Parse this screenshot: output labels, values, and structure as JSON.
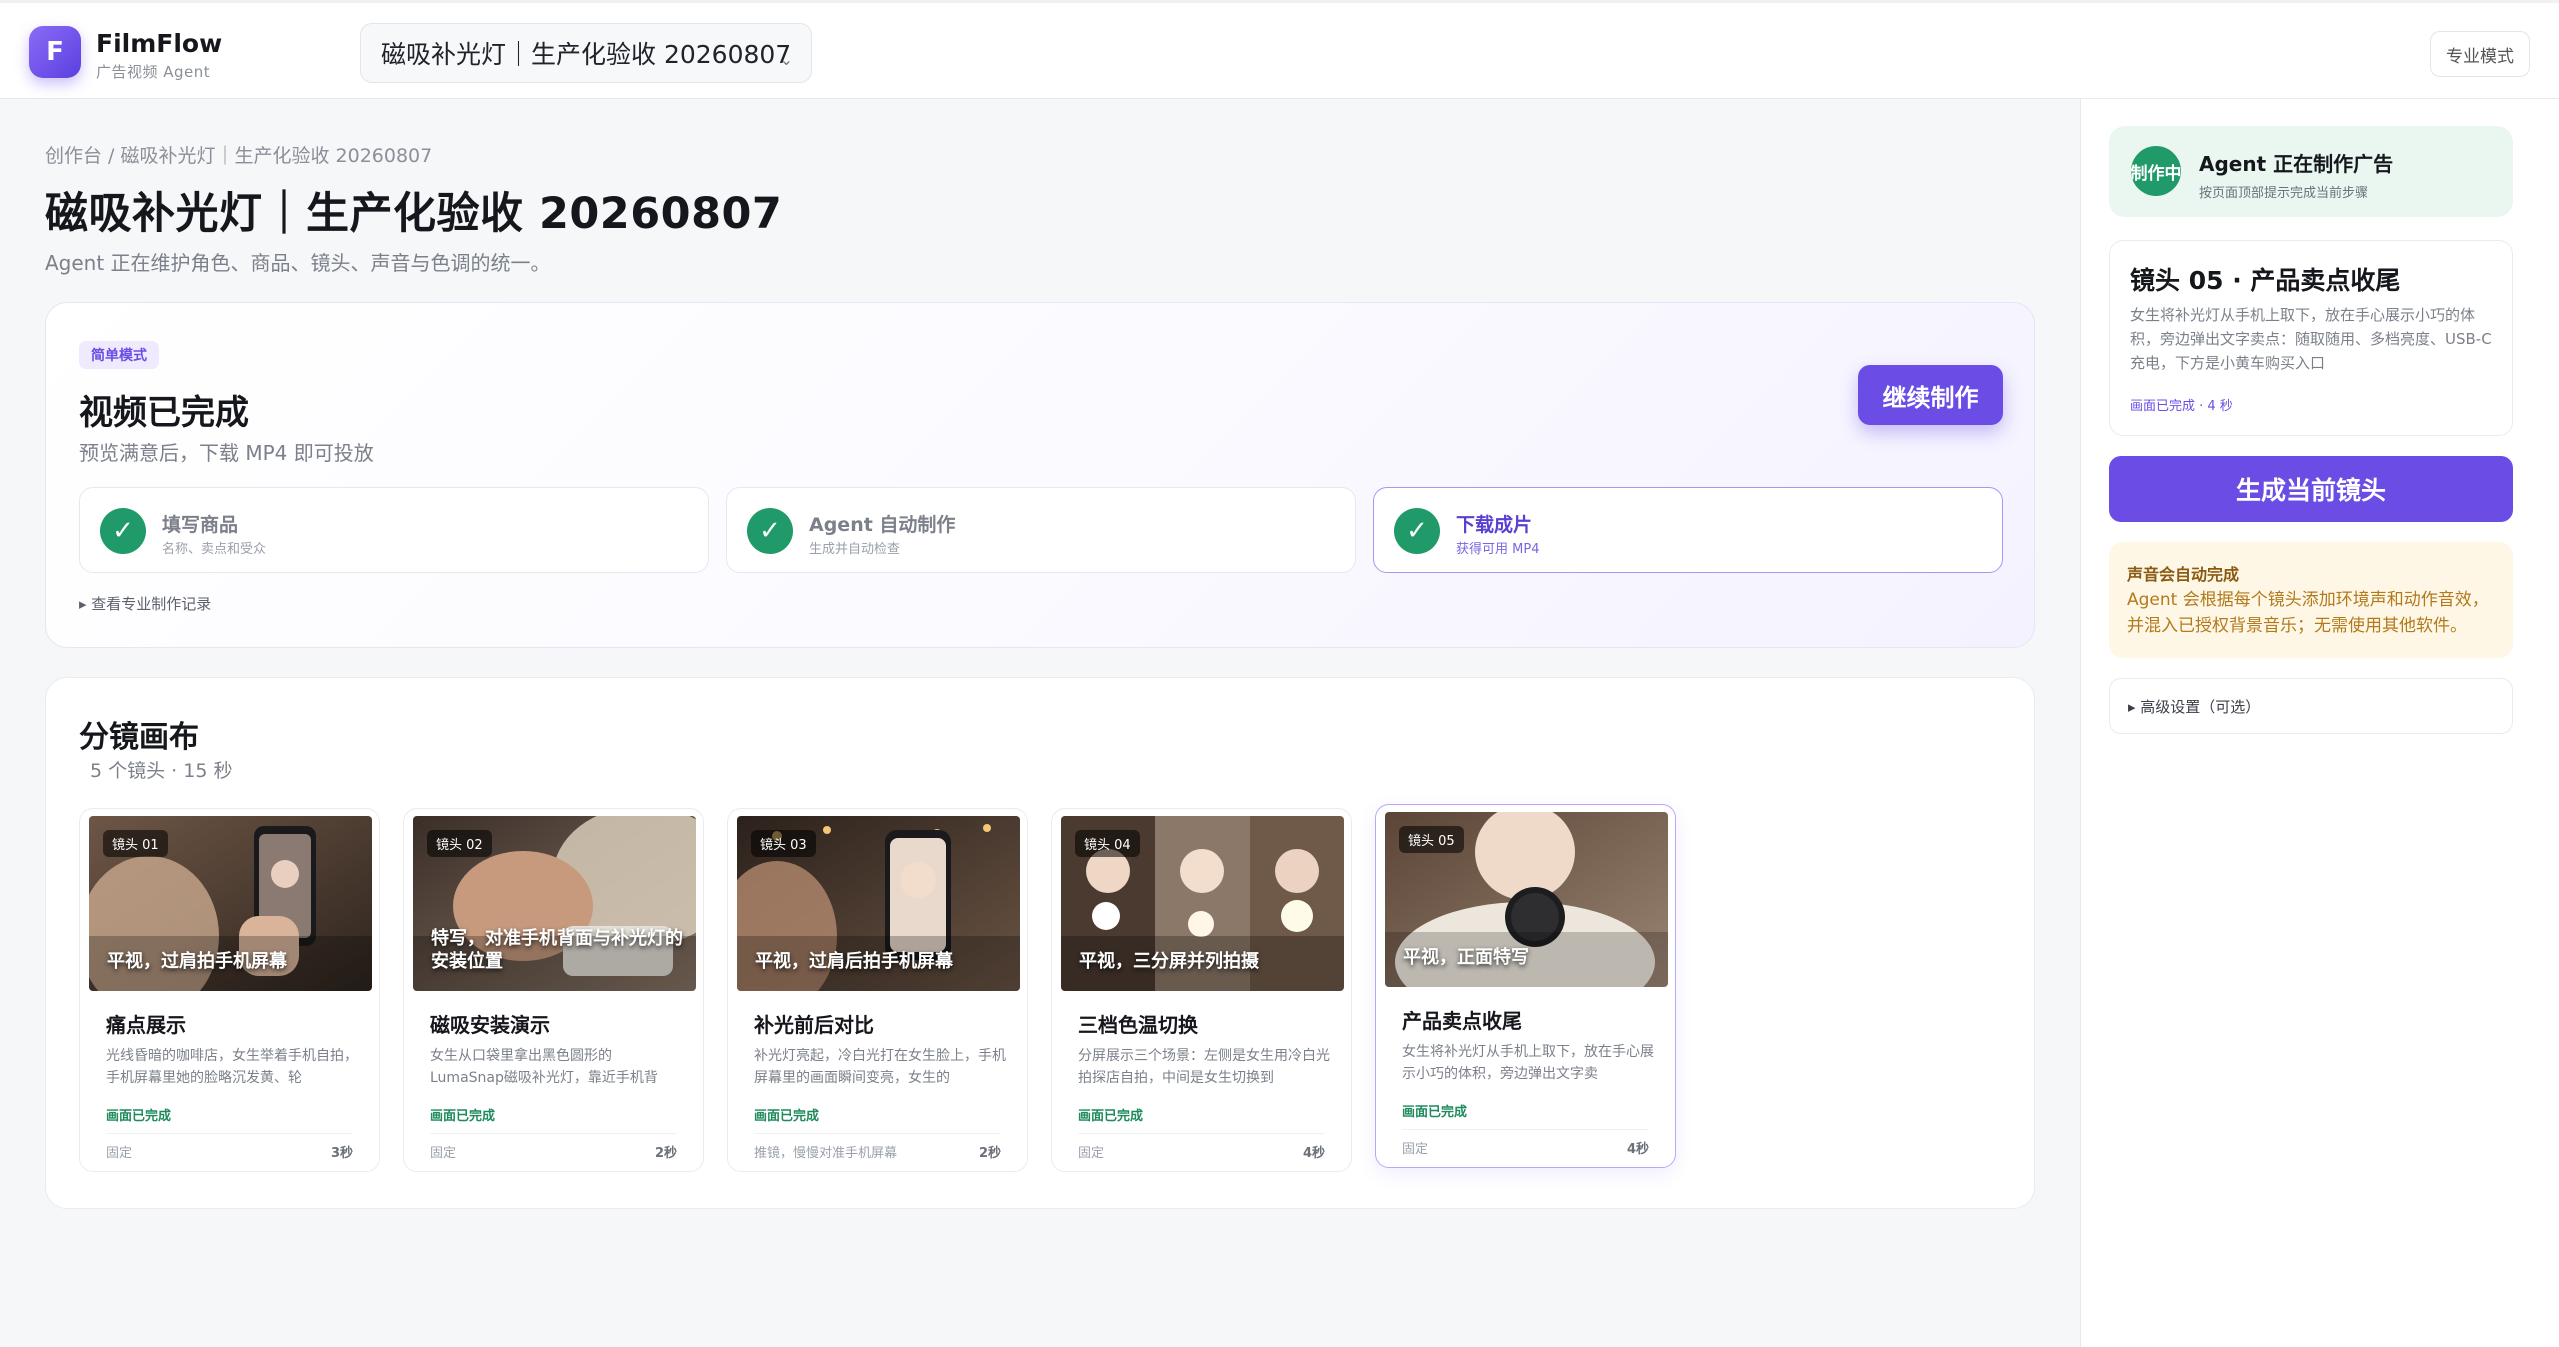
{
  "app": {
    "logo_letter": "F",
    "name": "FilmFlow",
    "subtitle": "广告视频 Agent",
    "project_select": "磁吸补光灯｜生产化验收 20260807",
    "project_chevron": "⌄",
    "pro_mode_label": "专业模式"
  },
  "page": {
    "breadcrumb": "创作台 / 磁吸补光灯｜生产化验收 20260807",
    "title": "磁吸补光灯｜生产化验收 20260807",
    "subtitle": "Agent 正在维护角色、商品、镜头、声音与色调的统一。"
  },
  "status_card": {
    "mode_badge": "简单模式",
    "title": "视频已完成",
    "subtitle": "预览满意后，下载 MP4 即可投放",
    "continue_label": "继续制作",
    "record_link": "▸ 查看专业制作记录",
    "steps": [
      {
        "check": "✓",
        "title": "填写商品",
        "desc": "名称、卖点和受众"
      },
      {
        "check": "✓",
        "title": "Agent 自动制作",
        "desc": "生成并自动检查"
      },
      {
        "check": "✓",
        "title": "下载成片",
        "desc": "获得可用 MP4"
      }
    ]
  },
  "board": {
    "title": "分镜画布",
    "subtitle": "5 个镜头 · 15 秒",
    "shots": [
      {
        "tag": "镜头 01",
        "caption": "平视，过肩拍手机屏幕",
        "name": "痛点展示",
        "desc": "光线昏暗的咖啡店，女生举着手机自拍，手机屏幕里她的脸略沉发黄、轮",
        "status": "画面已完成",
        "move": "固定",
        "duration": "3秒"
      },
      {
        "tag": "镜头 02",
        "caption": "特写，对准手机背面与补光灯的安装位置",
        "name": "磁吸安装演示",
        "desc": "女生从口袋里拿出黑色圆形的LumaSnap磁吸补光灯，靠近手机背",
        "status": "画面已完成",
        "move": "固定",
        "duration": "2秒"
      },
      {
        "tag": "镜头 03",
        "caption": "平视，过肩后拍手机屏幕",
        "name": "补光前后对比",
        "desc": "补光灯亮起，冷白光打在女生脸上，手机屏幕里的画面瞬间变亮，女生的",
        "status": "画面已完成",
        "move": "推镜，慢慢对准手机屏幕",
        "duration": "2秒"
      },
      {
        "tag": "镜头 04",
        "caption": "平视，三分屏并列拍摄",
        "name": "三档色温切换",
        "desc": "分屏展示三个场景：左侧是女生用冷白光拍探店自拍，中间是女生切换到",
        "status": "画面已完成",
        "move": "固定",
        "duration": "4秒"
      },
      {
        "tag": "镜头 05",
        "caption": "平视，正面特写",
        "name": "产品卖点收尾",
        "desc": "女生将补光灯从手机上取下，放在手心展示小巧的体积，旁边弹出文字卖",
        "status": "画面已完成",
        "move": "固定",
        "duration": "4秒"
      }
    ]
  },
  "side": {
    "agent_pill": "制作中",
    "agent_title": "Agent 正在制作广告",
    "agent_sub": "按页面顶部提示完成当前步骤",
    "detail_title": "镜头 05 · 产品卖点收尾",
    "detail_desc": "女生将补光灯从手机上取下，放在手心展示小巧的体积，旁边弹出文字卖点：随取随用、多档亮度、USB-C充电，下方是小黄车购买入口",
    "detail_status": "画面已完成 · 4 秒",
    "generate_label": "生成当前镜头",
    "sound_title": "声音会自动完成",
    "sound_desc": "Agent 会根据每个镜头添加环境声和动作音效，并混入已授权背景音乐；无需使用其他软件。",
    "advanced_label": "▸ 高级设置（可选）"
  },
  "colors": {
    "accent": "#6b4de6",
    "success": "#1f9a68",
    "warn_bg": "#fff7e6",
    "warn_text": "#b27a1c"
  }
}
